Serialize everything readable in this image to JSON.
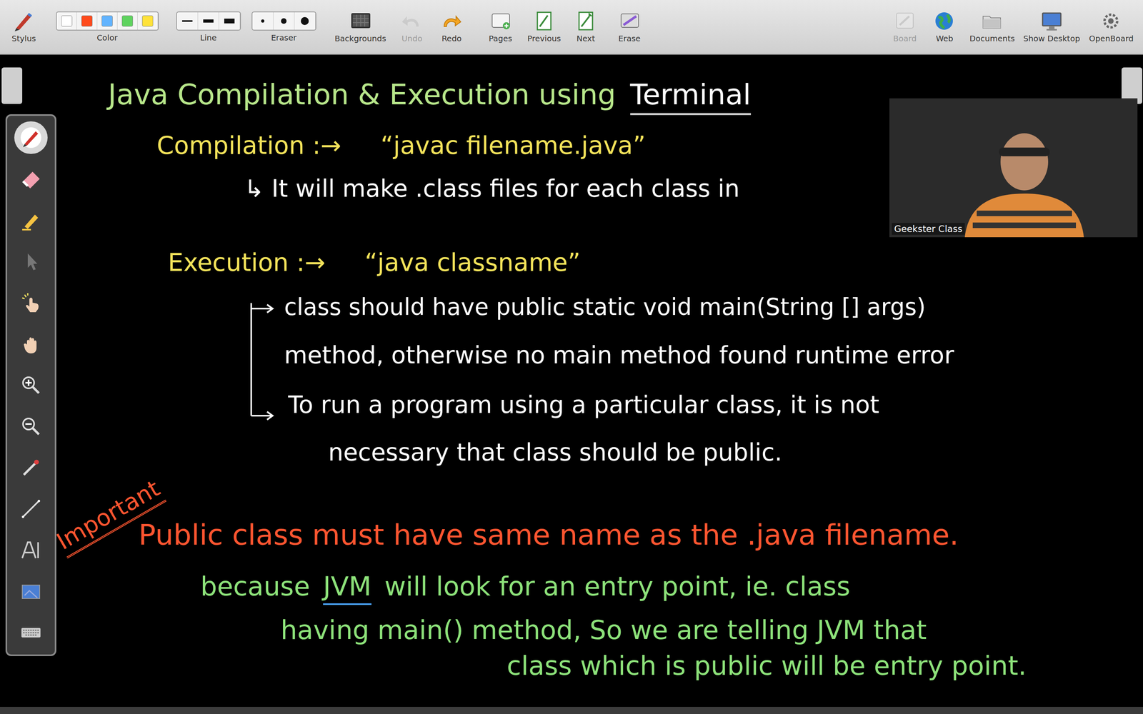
{
  "toolbar": {
    "left": [
      {
        "label": "Stylus",
        "kind": "button",
        "disabled": false
      },
      {
        "label": "Color",
        "kind": "swatches",
        "disabled": false,
        "swatches": [
          {
            "color": "#ffffff"
          },
          {
            "color": "#ff4a1c"
          },
          {
            "color": "#62b4ff"
          },
          {
            "color": "#5fd35f"
          },
          {
            "color": "#ffe23a"
          }
        ]
      },
      {
        "label": "Line",
        "kind": "lines",
        "disabled": false
      },
      {
        "label": "Eraser",
        "kind": "dots",
        "disabled": false
      },
      {
        "label": "Backgrounds",
        "kind": "button",
        "disabled": false
      },
      {
        "label": "Undo",
        "kind": "button",
        "disabled": true
      },
      {
        "label": "Redo",
        "kind": "button",
        "disabled": false
      },
      {
        "label": "Pages",
        "kind": "button",
        "disabled": false
      },
      {
        "label": "Previous",
        "kind": "button",
        "disabled": false
      },
      {
        "label": "Next",
        "kind": "button",
        "disabled": false
      },
      {
        "label": "Erase",
        "kind": "button",
        "disabled": false
      }
    ],
    "right": [
      {
        "label": "Board",
        "kind": "button",
        "disabled": true
      },
      {
        "label": "Web",
        "kind": "button",
        "disabled": false
      },
      {
        "label": "Documents",
        "kind": "button",
        "disabled": false
      },
      {
        "label": "Show Desktop",
        "kind": "button",
        "disabled": false
      },
      {
        "label": "OpenBoard",
        "kind": "button",
        "disabled": false
      }
    ]
  },
  "palette": {
    "tools": [
      {
        "selected": true
      },
      {
        "selected": false
      },
      {
        "selected": false
      },
      {
        "selected": false
      },
      {
        "selected": false
      },
      {
        "selected": false
      },
      {
        "selected": false
      },
      {
        "selected": false
      },
      {
        "selected": false
      },
      {
        "selected": false
      },
      {
        "selected": false
      },
      {
        "selected": false
      },
      {
        "selected": false
      }
    ]
  },
  "video": {
    "name": "Geekster Class"
  },
  "board": {
    "lines": [
      {
        "kind": "line",
        "segments": [
          {
            "text": "Java Compilation & Execution using",
            "color": "#b7e68a",
            "underlined": false
          },
          {
            "text": "Terminal",
            "color": "#ffffff",
            "underlined": true
          }
        ]
      },
      {
        "kind": "line",
        "segments": [
          {
            "text": "Compilation :→",
            "color": "#f3e35a",
            "underlined": false
          },
          {
            "text": "“javac filename.java”",
            "color": "#f3e35a",
            "underlined": false
          }
        ]
      },
      {
        "kind": "line",
        "segments": [
          {
            "text": "↳ It will make .class files for each class in",
            "color": "#ffffff",
            "underlined": false
          }
        ]
      },
      {
        "kind": "line",
        "segments": [
          {
            "text": "Execution :→",
            "color": "#f3e35a",
            "underlined": false
          },
          {
            "text": "“java classname”",
            "color": "#f3e35a",
            "underlined": false
          }
        ]
      },
      {
        "kind": "line",
        "segments": [
          {
            "text": "class should have public static void main(String [] args)",
            "color": "#ffffff",
            "underlined": false
          }
        ]
      },
      {
        "kind": "line",
        "segments": [
          {
            "text": "method, otherwise no main method found runtime error",
            "color": "#ffffff",
            "underlined": false
          }
        ]
      },
      {
        "kind": "line",
        "segments": [
          {
            "text": "To run a program using a particular class, it is not",
            "color": "#ffffff",
            "underlined": false
          }
        ]
      },
      {
        "kind": "line",
        "segments": [
          {
            "text": "necessary that class should be public.",
            "color": "#ffffff",
            "underlined": false
          }
        ]
      },
      {
        "kind": "stamp",
        "segments": [
          {
            "text": "Important",
            "color": "#ff5530",
            "underlined": true
          }
        ]
      },
      {
        "kind": "line",
        "segments": [
          {
            "text": "Public class must have same name as the .java filename.",
            "color": "#ff5530",
            "underlined": false
          }
        ]
      },
      {
        "kind": "line",
        "segments": [
          {
            "text": "because",
            "color": "#8de27a",
            "underlined": false
          },
          {
            "text": "JVM",
            "color": "#8de27a",
            "underlined": true
          },
          {
            "text": "will look for an entry point, ie. class",
            "color": "#8de27a",
            "underlined": false
          }
        ]
      },
      {
        "kind": "line",
        "segments": [
          {
            "text": "having main() method, So we are telling JVM that",
            "color": "#8de27a",
            "underlined": false
          }
        ]
      },
      {
        "kind": "line",
        "segments": [
          {
            "text": "class which is public will be entry point.",
            "color": "#8de27a",
            "underlined": false
          }
        ]
      }
    ]
  }
}
